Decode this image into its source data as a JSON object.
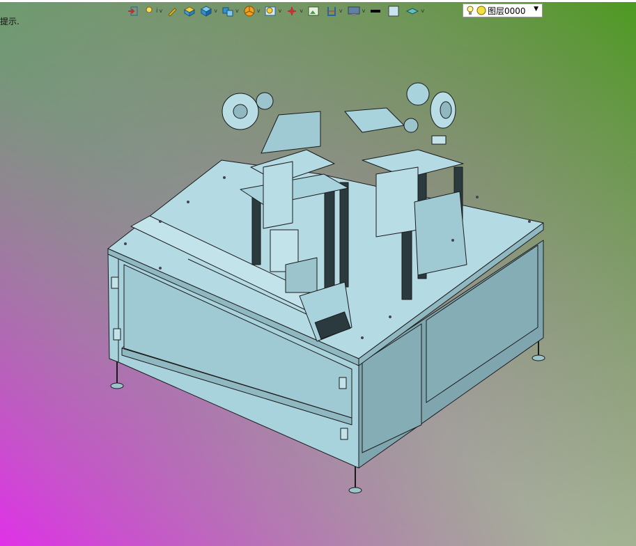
{
  "status": {
    "hint_text": "提示."
  },
  "toolbar": {
    "items": [
      {
        "icon": "import-icon"
      },
      {
        "icon": "light-bulb-icon"
      },
      {
        "icon": "pen-edit-icon"
      },
      {
        "icon": "yellow-box-icon"
      },
      {
        "icon": "blue-cube-icon"
      },
      {
        "icon": "cube-stack-icon"
      },
      {
        "icon": "pie-render-icon"
      },
      {
        "icon": "zoom-view-icon"
      },
      {
        "icon": "axis-cross-icon"
      },
      {
        "icon": "image-frame-icon"
      },
      {
        "icon": "bracket-icon"
      },
      {
        "icon": "monitor-icon"
      },
      {
        "icon": "line-weight-icon"
      },
      {
        "icon": "color-square-icon"
      },
      {
        "icon": "layer-plane-icon"
      }
    ],
    "layer_select": {
      "value": "图层0000",
      "icons": [
        "bulb-icon",
        "yellow-circle-icon"
      ]
    }
  },
  "colors": {
    "bg_top_left": "#4f9a5f",
    "bg_top_right": "#4d9a20",
    "bg_bottom_left": "#e030e8",
    "bg_bottom_right": "#b0c8a0",
    "machine_fill": "#a8d2dc",
    "machine_dark": "#7fa6ae",
    "outline": "#1a1a1a"
  }
}
